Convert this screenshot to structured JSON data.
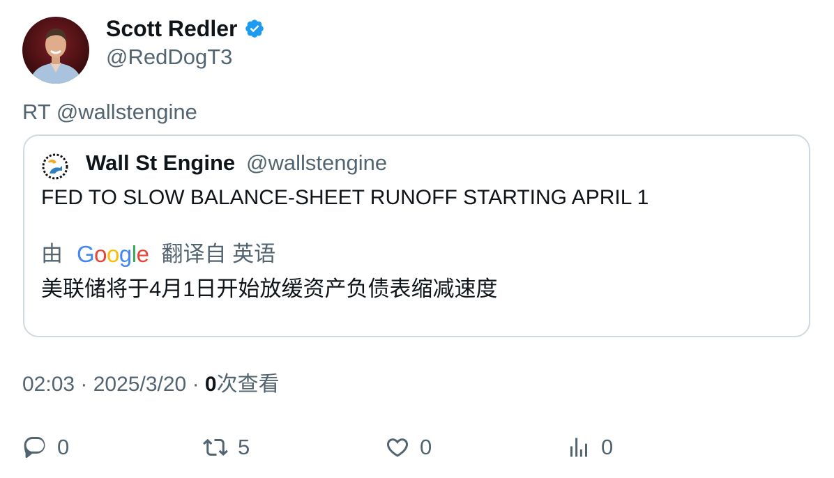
{
  "author": {
    "name": "Scott Redler",
    "handle": "@RedDogT3",
    "verified_icon": "verified-badge-icon"
  },
  "retweet_text": "RT @wallstengine",
  "quote": {
    "name": "Wall St Engine",
    "handle": "@wallstengine",
    "text": "FED TO SLOW BALANCE-SHEET RUNOFF STARTING APRIL 1",
    "translation": {
      "prefix": "由",
      "provider": "Google",
      "suffix": "翻译自 英语",
      "text": "美联储将于4月1日开始放缓资产负债表缩减速度"
    }
  },
  "meta": {
    "time": "02:03",
    "separator": "·",
    "date": "2025/3/20",
    "views_count": "0",
    "views_label": "次查看"
  },
  "actions": {
    "reply_count": "0",
    "retweet_count": "5",
    "like_count": "0",
    "views_count": "0"
  },
  "colors": {
    "text_primary": "#0f1419",
    "text_secondary": "#536471",
    "border": "#cfd9de",
    "verified": "#1d9bf0"
  }
}
